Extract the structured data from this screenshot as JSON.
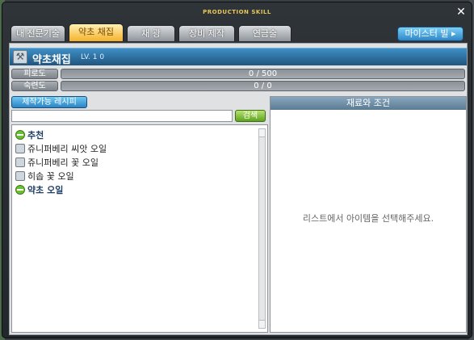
{
  "window": {
    "title": "PRODUCTION SKILL",
    "close_label": "✕"
  },
  "tabs": [
    {
      "label": "내 전문기술",
      "active": false
    },
    {
      "label": "약초 채집",
      "active": true
    },
    {
      "label": "채 광",
      "active": false
    },
    {
      "label": "장비 제작",
      "active": false
    },
    {
      "label": "연금술",
      "active": false
    }
  ],
  "meister_button": "마이스터 빌 ▸",
  "skill": {
    "name": "약초채집",
    "level": "LV. 1 0",
    "icon": "herb-pick-icon"
  },
  "stats": [
    {
      "label": "피로도",
      "value": "0 / 500",
      "fill": 0
    },
    {
      "label": "숙련도",
      "value": "0 / 0",
      "fill": 0
    }
  ],
  "recipe_button": "제작가능 레시피",
  "search": {
    "value": "",
    "button": "검색"
  },
  "list": [
    {
      "type": "category",
      "state": "expanded",
      "label": "추천"
    },
    {
      "type": "recipe",
      "label": "쥬니퍼베리 씨앗 오일"
    },
    {
      "type": "recipe",
      "label": "쥬니퍼베리 꽃 오일"
    },
    {
      "type": "recipe",
      "label": "히솝 꽃 오일"
    },
    {
      "type": "category",
      "state": "collapsed",
      "label": "약초 오일"
    }
  ],
  "right_panel": {
    "header": "재료와 조건",
    "placeholder": "리스트에서 아이템을 선택해주세요."
  }
}
